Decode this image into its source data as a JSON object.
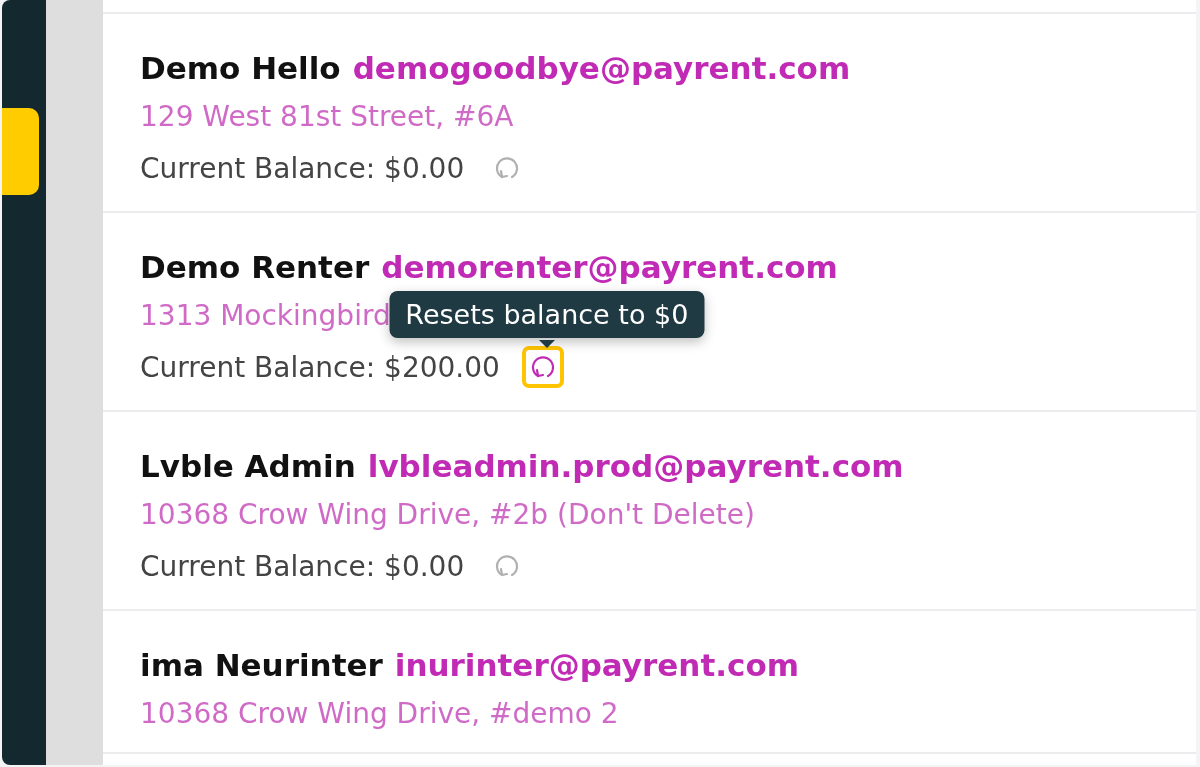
{
  "sidebar": {
    "items": [
      {
        "selected": true
      }
    ]
  },
  "renters": [
    {
      "name": "Demo Hello",
      "email": "demogoodbye@payrent.com",
      "address": "129 West 81st Street, #6A",
      "balance": "Current Balance: $0.00",
      "reset_highlighted": false
    },
    {
      "name": "Demo Renter",
      "email": "demorenter@payrent.com",
      "address": "1313 Mockingbird",
      "balance": "Current Balance: $200.00",
      "reset_highlighted": true,
      "tooltip": "Resets balance to $0"
    },
    {
      "name": "Lvble Admin",
      "email": "lvbleadmin.prod@payrent.com",
      "address": "10368 Crow Wing Drive, #2b (Don't Delete)",
      "balance": "Current Balance: $0.00",
      "reset_highlighted": false
    },
    {
      "name": "ima Neurinter",
      "email": "inurinter@payrent.com",
      "address": "10368 Crow Wing Drive, #demo 2"
    }
  ]
}
